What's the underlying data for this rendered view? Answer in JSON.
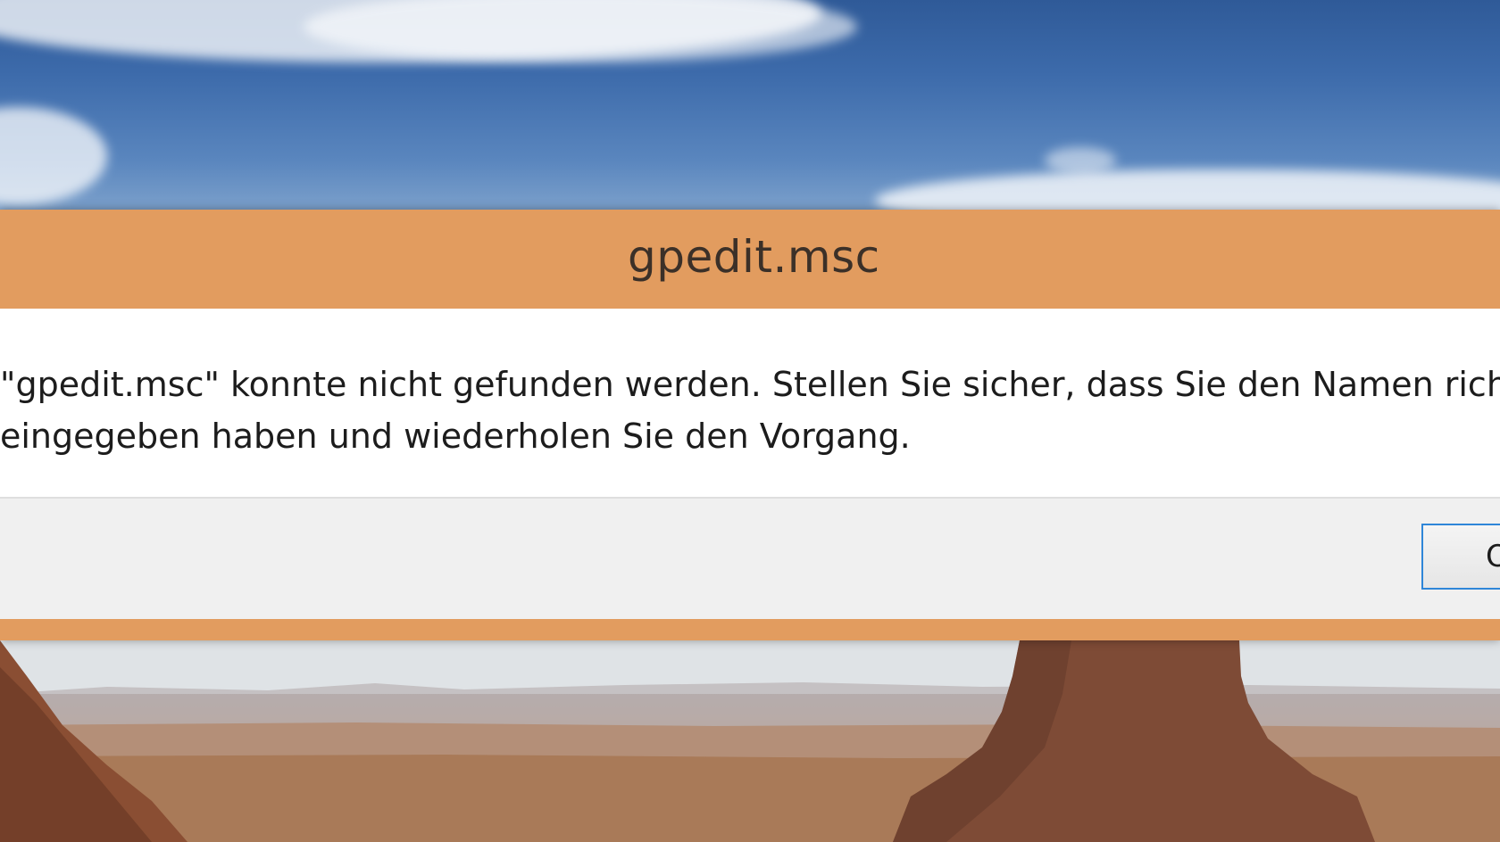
{
  "dialog": {
    "title": "gpedit.msc",
    "message_line1": "\"gpedit.msc\" konnte nicht gefunden werden. Stellen Sie sicher, dass Sie den Namen richtig",
    "message_line2": "eingegeben haben und wiederholen Sie den Vorgang.",
    "ok_label": "OK",
    "accent_color": "#e29c5f"
  },
  "desktop": {
    "wallpaper": "desert-mesa-landscape"
  }
}
